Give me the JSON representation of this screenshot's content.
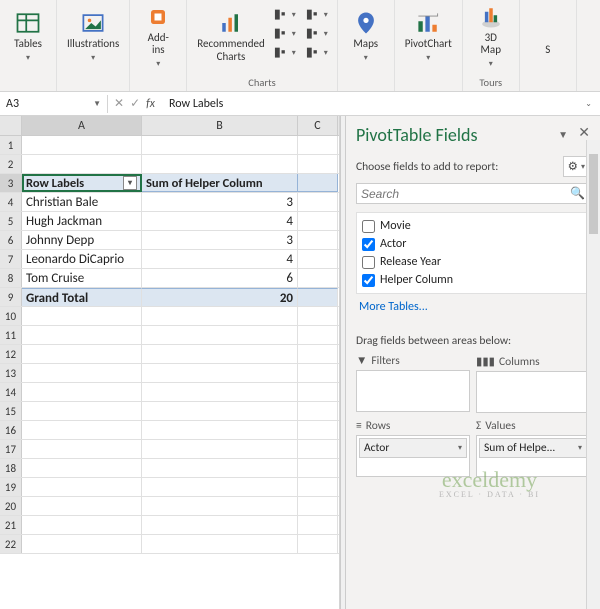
{
  "ribbon": {
    "groups": [
      {
        "label": "",
        "items": [
          {
            "label": "Tables",
            "icon": "tables",
            "caret": true
          }
        ]
      },
      {
        "label": "",
        "items": [
          {
            "label": "Illustrations",
            "icon": "illus",
            "caret": true
          }
        ]
      },
      {
        "label": "",
        "items": [
          {
            "label": "Add-\nins",
            "icon": "addins",
            "caret": true
          }
        ]
      },
      {
        "label": "Charts",
        "items": [
          {
            "label": "Recommended\nCharts",
            "icon": "reccharts"
          }
        ],
        "minis": true
      },
      {
        "label": "",
        "items": [
          {
            "label": "Maps",
            "icon": "maps",
            "caret": true
          }
        ]
      },
      {
        "label": "",
        "items": [
          {
            "label": "PivotChart",
            "icon": "pivotchart",
            "caret": true
          }
        ]
      },
      {
        "label": "Tours",
        "items": [
          {
            "label": "3D\nMap",
            "icon": "3dmap",
            "caret": true
          }
        ]
      },
      {
        "label": "",
        "items": [
          {
            "label": "S",
            "icon": "none"
          }
        ]
      }
    ]
  },
  "namebox": "A3",
  "formula": "Row Labels",
  "columns": [
    "A",
    "B",
    "C"
  ],
  "pivot": {
    "header_a": "Row Labels",
    "header_b": "Sum of Helper Column",
    "rows": [
      {
        "label": "Christian Bale",
        "value": "3"
      },
      {
        "label": "Hugh Jackman",
        "value": "4"
      },
      {
        "label": "Johnny Depp",
        "value": "3"
      },
      {
        "label": "Leonardo DiCaprio",
        "value": "4"
      },
      {
        "label": "Tom Cruise",
        "value": "6"
      }
    ],
    "total_label": "Grand Total",
    "total_value": "20"
  },
  "row_numbers": [
    1,
    2,
    3,
    4,
    5,
    6,
    7,
    8,
    9,
    10,
    11,
    12,
    13,
    14,
    15,
    16,
    17,
    18,
    19,
    20,
    21,
    22
  ],
  "pane": {
    "title": "PivotTable Fields",
    "subtitle": "Choose fields to add to report:",
    "search_placeholder": "Search",
    "fields": [
      {
        "name": "Movie",
        "checked": false
      },
      {
        "name": "Actor",
        "checked": true
      },
      {
        "name": "Release Year",
        "checked": false
      },
      {
        "name": "Helper Column",
        "checked": true
      }
    ],
    "more": "More Tables...",
    "drag_label": "Drag fields between areas below:",
    "areas": {
      "filters": {
        "label": "Filters",
        "items": []
      },
      "columns": {
        "label": "Columns",
        "items": []
      },
      "rows": {
        "label": "Rows",
        "items": [
          "Actor"
        ]
      },
      "values": {
        "label": "Values",
        "items": [
          "Sum of Helpe..."
        ]
      }
    }
  },
  "watermark": {
    "main": "exceldemy",
    "sub": "EXCEL · DATA · BI"
  }
}
